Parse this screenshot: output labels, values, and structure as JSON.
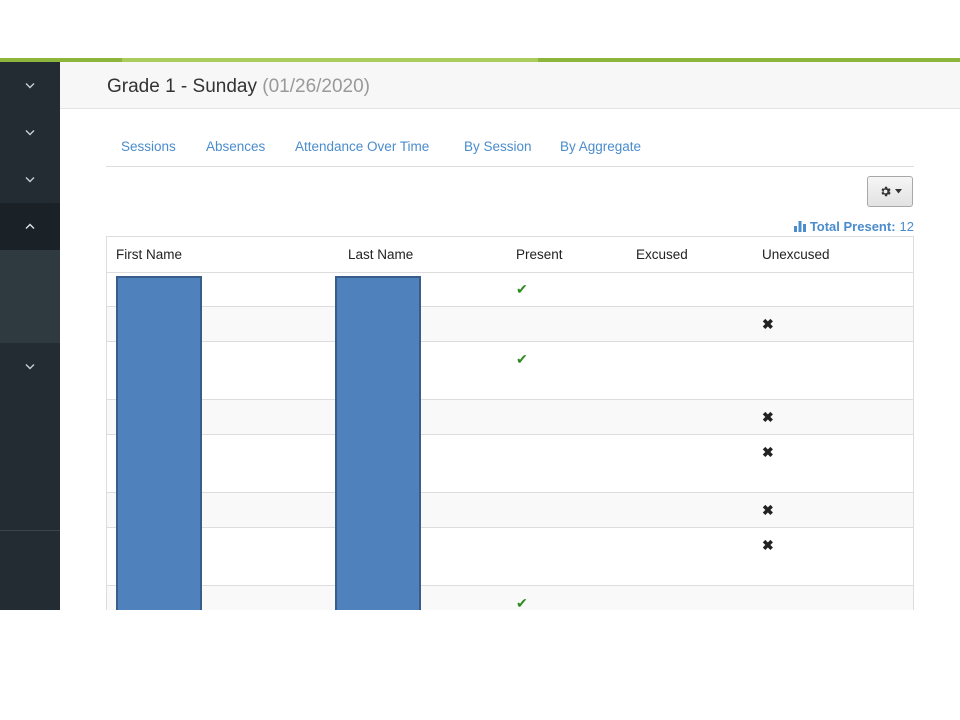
{
  "page": {
    "title": "Grade 1 - Sunday",
    "date": "(01/26/2020)"
  },
  "tabs": [
    {
      "label": "Sessions"
    },
    {
      "label": "Absences"
    },
    {
      "label": "Attendance Over Time"
    },
    {
      "label": "By Session"
    },
    {
      "label": "By Aggregate"
    }
  ],
  "summary": {
    "total_present_label": "Total Present:",
    "total_present_value": "12"
  },
  "table": {
    "columns": [
      "First Name",
      "Last Name",
      "Present",
      "Excused",
      "Unexcused"
    ],
    "rows": [
      {
        "first_name": "",
        "last_name": "",
        "status": "present"
      },
      {
        "first_name": "",
        "last_name": "",
        "status": "unexcused"
      },
      {
        "first_name": "",
        "last_name": "",
        "status": "present"
      },
      {
        "first_name": "",
        "last_name": "",
        "status": "unexcused"
      },
      {
        "first_name": "",
        "last_name": "",
        "status": "unexcused"
      },
      {
        "first_name": "",
        "last_name": "",
        "status": "unexcused"
      },
      {
        "first_name": "",
        "last_name": "",
        "status": "unexcused"
      },
      {
        "first_name": "",
        "last_name": "",
        "status": "present"
      }
    ],
    "marks": {
      "check": "✔",
      "cross": "✖"
    }
  },
  "icons": {
    "sidebar_chevrons": [
      "chevron-down-icon",
      "chevron-down-icon",
      "chevron-down-icon",
      "chevron-up-icon",
      "chevron-down-icon"
    ],
    "settings": "gear-icon",
    "dropdown": "caret-down-icon",
    "chart": "bar-chart-icon"
  },
  "colors": {
    "accent_green": "#8db53c",
    "link_blue": "#4a8ccc",
    "sidebar_bg": "#222c32",
    "check_green": "#2e8a1e",
    "redaction_blue": "#4f81bd"
  }
}
